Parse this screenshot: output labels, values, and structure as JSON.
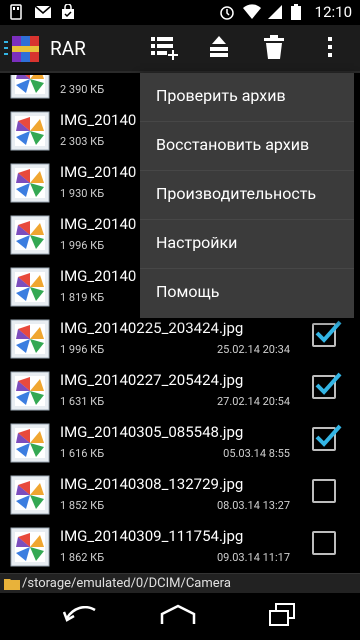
{
  "statusbar": {
    "time": "12:10",
    "left_icons": [
      "android-storage-icon",
      "gmail-icon",
      "shopping-bag-icon"
    ],
    "right_icons": [
      "alarm-icon",
      "wifi-icon",
      "signal-icon",
      "battery-icon"
    ]
  },
  "actionbar": {
    "title": "RAR",
    "buttons": [
      "add-to-archive-icon",
      "extract-icon",
      "delete-icon",
      "overflow-menu-icon"
    ]
  },
  "menu": {
    "items": [
      "Проверить архив",
      "Восстановить архив",
      "Производительность",
      "Настройки",
      "Помощь"
    ]
  },
  "files": [
    {
      "name": "",
      "size": "2 390 КБ",
      "date": "",
      "checked": false
    },
    {
      "name": "IMG_20140",
      "size": "2 303 КБ",
      "date": "",
      "checked": false
    },
    {
      "name": "IMG_20140",
      "size": "1 930 КБ",
      "date": "",
      "checked": false
    },
    {
      "name": "IMG_20140",
      "size": "1 996 КБ",
      "date": "",
      "checked": false
    },
    {
      "name": "IMG_20140",
      "size": "1 819 КБ",
      "date": "",
      "checked": false
    },
    {
      "name": "IMG_20140225_203424.jpg",
      "size": "1 996 КБ",
      "date": "25.02.14 20:34",
      "checked": true
    },
    {
      "name": "IMG_20140227_205424.jpg",
      "size": "1 631 КБ",
      "date": "27.02.14 20:54",
      "checked": true
    },
    {
      "name": "IMG_20140305_085548.jpg",
      "size": "1 616 КБ",
      "date": "05.03.14 8:55",
      "checked": true
    },
    {
      "name": "IMG_20140308_132729.jpg",
      "size": "1 852 КБ",
      "date": "08.03.14 13:27",
      "checked": false
    },
    {
      "name": "IMG_20140309_111754.jpg",
      "size": "1 862 КБ",
      "date": "09.03.14 11:17",
      "checked": false
    }
  ],
  "pathbar": {
    "path": "/storage/emulated/0/DCIM/Camera"
  },
  "navbar": {
    "buttons": [
      "back-icon",
      "home-icon",
      "recents-icon"
    ]
  },
  "colors": {
    "accent": "#33b5e5",
    "menu_bg": "#3b3b3b",
    "actionbar_bg": "#1c1c1c"
  }
}
